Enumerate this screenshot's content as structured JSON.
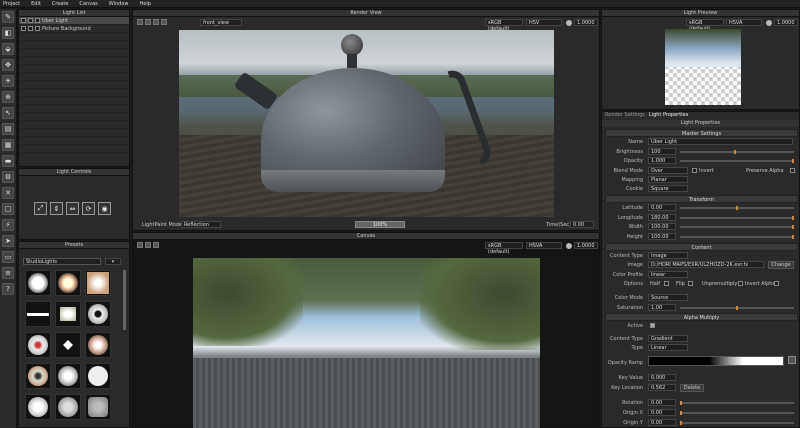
{
  "menu": [
    "Project",
    "Edit",
    "Create",
    "Canvas",
    "Window",
    "Help"
  ],
  "light_list": {
    "title": "Light List",
    "items": [
      "Uber Light",
      "Picture Background"
    ]
  },
  "light_controls": {
    "title": "Light Controls"
  },
  "presets": {
    "title": "Presets",
    "selected": "StudioLights"
  },
  "render_view": {
    "title": "Render View",
    "camera": "front_view",
    "colorspace": "sRGB (default)",
    "mode": "HSV",
    "exposure": "1.0000",
    "paint_mode_label": "LightPaint Mode",
    "paint_mode": "Reflection",
    "progress": "100%",
    "time_label": "Time(Sec)",
    "time": "0.00"
  },
  "canvas": {
    "title": "Canvas",
    "colorspace": "sRGB (default)",
    "mode": "HSVA",
    "exposure": "1.0000"
  },
  "light_preview": {
    "title": "Light Preview",
    "colorspace": "sRGB (default)",
    "mode": "HSVA",
    "exposure": "1.0000"
  },
  "props": {
    "tabs": [
      "Render Settings",
      "Light Properties"
    ],
    "title": "Light Properties",
    "master": "Master Settings",
    "name_label": "Name",
    "name": "Uber Light",
    "brightness_label": "Brightness",
    "brightness": "100",
    "opacity_label": "Opacity",
    "opacity": "1.000",
    "blend_label": "Blend Mode",
    "blend": "Over",
    "invert_label": "Invert",
    "preserve_label": "Preserve Alpha",
    "mapping_label": "Mapping",
    "mapping": "Planar",
    "cookie_label": "Cookie",
    "cookie": "Square",
    "transform": "Transform",
    "latitude_label": "Latitude",
    "latitude": "0.00",
    "longitude_label": "Longitude",
    "longitude": "180.00",
    "width_label": "Width",
    "width": "100.00",
    "height_label": "Height",
    "height": "100.00",
    "content": "Content",
    "ctype_label": "Content Type",
    "ctype": "Image",
    "image_label": "Image",
    "image": "D:/HDRI MAPS/EXR/ULZHOZD-2K.exr.fx",
    "change": "Change",
    "cprofile_label": "Color Profile",
    "cprofile": "linear",
    "options_label": "Options",
    "half": "Half",
    "flip": "Flip",
    "unpre": "Unpremultiply",
    "invalpha": "Invert Alpha",
    "cmode_label": "Color Mode",
    "cmode": "Source",
    "sat_label": "Saturation",
    "sat": "1.00",
    "alpha": "Alpha Multiply",
    "active_label": "Active",
    "actype_label": "Content Type",
    "actype": "Gradient",
    "type_label": "Type",
    "type": "Linear",
    "ramp_label": "Opacity Ramp",
    "keyval_label": "Key Value",
    "keyval": "0.000",
    "keyloc_label": "Key Location",
    "keyloc": "0.562",
    "delete": "Delete",
    "rot_label": "Rotation",
    "rot": "0.00",
    "ox_label": "Origin X",
    "ox": "0.00",
    "oy_label": "Origin Y",
    "oy": "0.00"
  }
}
